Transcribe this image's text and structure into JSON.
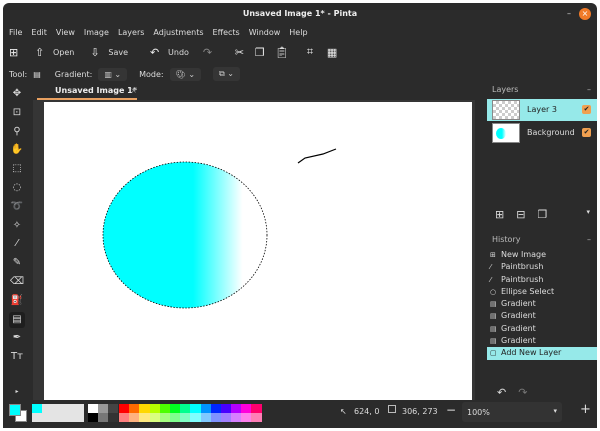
{
  "window": {
    "title": "Unsaved Image 1* - Pinta",
    "minimize": "–",
    "close": "×",
    "close_color": "#f07a28"
  },
  "menu": [
    "File",
    "Edit",
    "View",
    "Image",
    "Layers",
    "Adjustments",
    "Effects",
    "Window",
    "Help"
  ],
  "toolbar": {
    "open": "Open",
    "save": "Save",
    "undo": "Undo"
  },
  "tool_options": {
    "tool_label": "Tool:",
    "gradient_label": "Gradient:",
    "mode_label": "Mode:"
  },
  "tab": {
    "label": "Unsaved Image 1*",
    "close": "×"
  },
  "tools": [
    "move-selection",
    "move-selected",
    "zoom",
    "pan",
    "rectangle-select",
    "ellipse-select",
    "lasso-select",
    "magic-wand",
    "paintbrush",
    "pencil",
    "eraser",
    "paint-bucket",
    "gradient",
    "color-picker",
    "text"
  ],
  "layers": {
    "title": "Layers",
    "collapse": "–",
    "items": [
      {
        "name": "Layer 3",
        "visible": true,
        "selected": true
      },
      {
        "name": "Background",
        "visible": true,
        "selected": false
      }
    ]
  },
  "history": {
    "title": "History",
    "collapse": "–",
    "items": [
      {
        "label": "New Image",
        "icon": "new-image"
      },
      {
        "label": "Paintbrush",
        "icon": "paintbrush"
      },
      {
        "label": "Paintbrush",
        "icon": "paintbrush"
      },
      {
        "label": "Ellipse Select",
        "icon": "ellipse"
      },
      {
        "label": "Gradient",
        "icon": "gradient"
      },
      {
        "label": "Gradient",
        "icon": "gradient"
      },
      {
        "label": "Gradient",
        "icon": "gradient"
      },
      {
        "label": "Gradient",
        "icon": "gradient"
      },
      {
        "label": "Add New Layer",
        "icon": "layer",
        "selected": true
      }
    ]
  },
  "status": {
    "cursor": "624, 0",
    "selection": "306, 273",
    "zoom": "100%"
  },
  "colors": {
    "primary": "#00ffff",
    "secondary": "#ffffff",
    "accent": "#96e9e9",
    "palette_top": [
      "#ff0000",
      "#ff6a00",
      "#ffd800",
      "#b6ff00",
      "#4cff00",
      "#00ff21",
      "#00ff90",
      "#00ffff",
      "#0094ff",
      "#0026ff",
      "#4800ff",
      "#b200ff",
      "#ff00dc",
      "#ff006e"
    ],
    "palette_bottom": [
      "#ff7f7f",
      "#ffb27f",
      "#ffe97f",
      "#daff7f",
      "#a5ff7f",
      "#7fff8e",
      "#7fffc5",
      "#7fffff",
      "#7fc9ff",
      "#7f92ff",
      "#a17fff",
      "#d67fff",
      "#ff7fed",
      "#ff7fb6"
    ]
  }
}
